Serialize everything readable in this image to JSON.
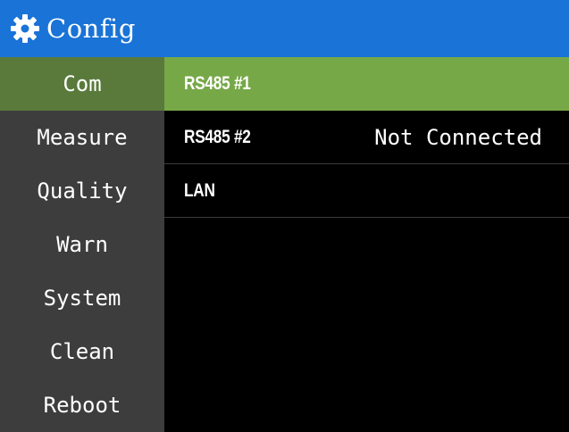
{
  "header": {
    "title": "Config",
    "icon": "gear-icon",
    "color": "#1a73d6"
  },
  "sidebar": {
    "active_index": 0,
    "active_color": "#5a7a3c",
    "items": [
      {
        "label": "Com"
      },
      {
        "label": "Measure"
      },
      {
        "label": "Quality"
      },
      {
        "label": "Warn"
      },
      {
        "label": "System"
      },
      {
        "label": "Clean"
      },
      {
        "label": "Reboot"
      }
    ]
  },
  "main": {
    "selected_index": 0,
    "selected_color": "#76a847",
    "rows": [
      {
        "label": "RS485 #1",
        "status": ""
      },
      {
        "label": "RS485 #2",
        "status": "Not Connected"
      },
      {
        "label": "LAN",
        "status": ""
      }
    ]
  }
}
